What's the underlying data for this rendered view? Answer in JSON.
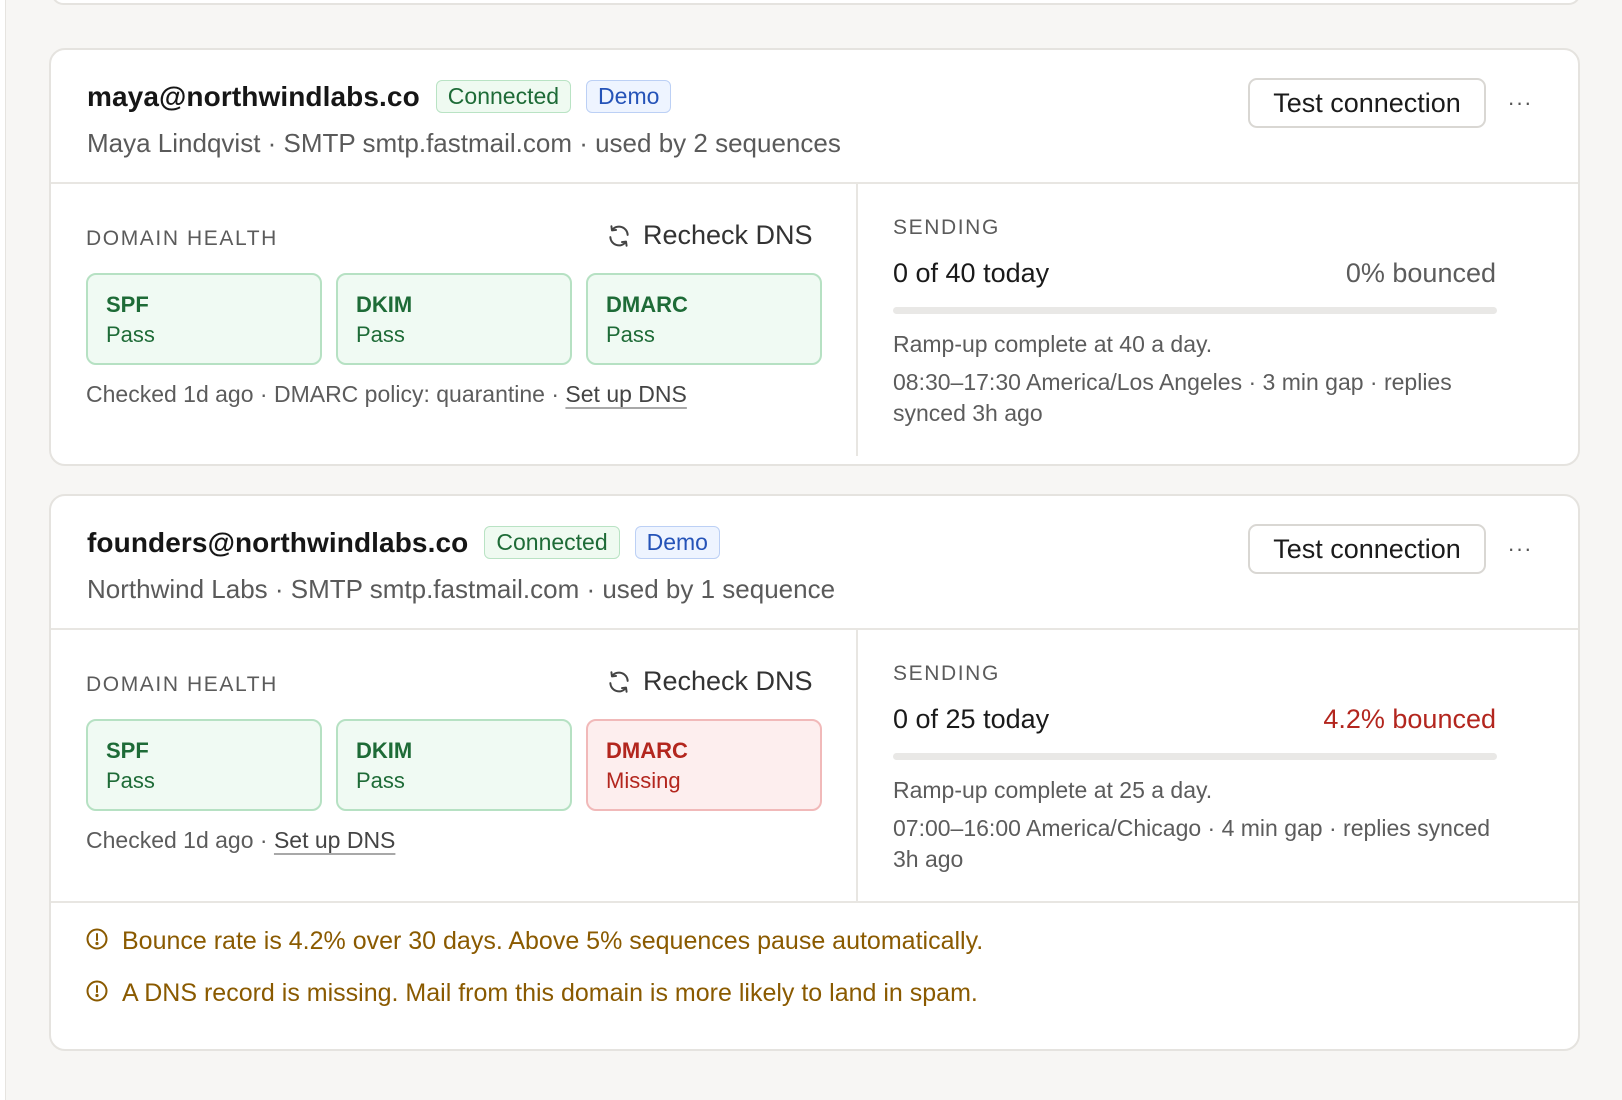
{
  "accounts": [
    {
      "address": "maya@northwindlabs.co",
      "status_badge": "Connected",
      "mode_badge": "Demo",
      "subtitle": "Maya Lindqvist · SMTP smtp.fastmail.com · used by 2 sequences",
      "test_button": "Test connection",
      "more_button": "···",
      "domain_health": {
        "label": "DOMAIN HEALTH",
        "recheck_label": "Recheck DNS",
        "records": [
          {
            "name": "SPF",
            "status": "Pass",
            "state": "ok"
          },
          {
            "name": "DKIM",
            "status": "Pass",
            "state": "ok"
          },
          {
            "name": "DMARC",
            "status": "Pass",
            "state": "ok"
          }
        ],
        "checked_text": "Checked 1d ago · DMARC policy: quarantine · ",
        "setup_link": "Set up DNS"
      },
      "sending": {
        "label": "SENDING",
        "sent_text": "0 of 40 today",
        "sent_progress": 0,
        "bounce_text": "0% bounced",
        "ramp_text": "Ramp-up complete at 40 a day.",
        "schedule_text": "08:30–17:30 America/Los Angeles · 3 min gap · replies synced 3h ago"
      }
    },
    {
      "address": "founders@northwindlabs.co",
      "status_badge": "Connected",
      "mode_badge": "Demo",
      "subtitle": "Northwind Labs · SMTP smtp.fastmail.com · used by 1 sequence",
      "test_button": "Test connection",
      "more_button": "···",
      "domain_health": {
        "label": "DOMAIN HEALTH",
        "recheck_label": "Recheck DNS",
        "records": [
          {
            "name": "SPF",
            "status": "Pass",
            "state": "ok"
          },
          {
            "name": "DKIM",
            "status": "Pass",
            "state": "ok"
          },
          {
            "name": "DMARC",
            "status": "Missing",
            "state": "missing"
          }
        ],
        "checked_text": "Checked 1d ago · ",
        "setup_link": "Set up DNS"
      },
      "sending": {
        "label": "SENDING",
        "sent_text": "0 of 25 today",
        "sent_progress": 0,
        "bounce_text": "4.2% bounced",
        "ramp_text": "Ramp-up complete at 25 a day.",
        "schedule_text": "07:00–16:00 America/Chicago · 4 min gap · replies synced 3h ago"
      },
      "warnings": [
        {
          "icon": "alert-circle-icon",
          "text": "Bounce rate is 4.2% over 30 days. Above 5% sequences pause automatically."
        },
        {
          "icon": "alert-circle-icon",
          "text": "A DNS record is missing. Mail from this domain is more likely to land in spam."
        }
      ]
    }
  ],
  "colors": {
    "pass": "#1e6b37",
    "fail": "#b3261e",
    "warning": "#8a5a00",
    "demo": "#2553b8"
  }
}
